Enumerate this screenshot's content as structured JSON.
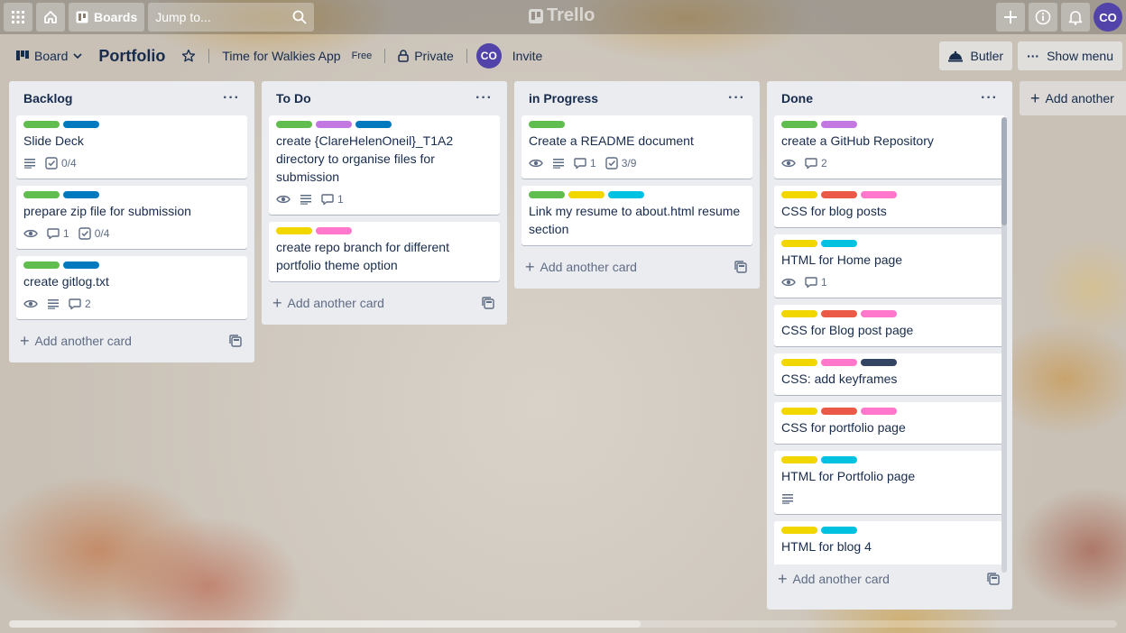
{
  "header": {
    "boards_label": "Boards",
    "search_placeholder": "Jump to...",
    "logo_text": "Trello",
    "avatar_initials": "CO"
  },
  "board": {
    "view_label": "Board",
    "title": "Portfolio",
    "workspace": "Time for Walkies App",
    "plan": "Free",
    "visibility": "Private",
    "member_initials": "CO",
    "invite_label": "Invite",
    "butler_label": "Butler",
    "show_menu_label": "Show menu"
  },
  "add_another_card": "Add another card",
  "add_another_list": "Add another",
  "colors": {
    "green": "#61bd4f",
    "blue": "#0079bf",
    "purple": "#c377e0",
    "yellow": "#f2d600",
    "pink": "#ff78cb",
    "red": "#eb5a46",
    "sky": "#00c2e0",
    "black": "#344563"
  },
  "lists": [
    {
      "name": "Backlog",
      "cards": [
        {
          "title": "Slide Deck",
          "labels": [
            "green",
            "blue"
          ],
          "badges": {
            "description": true,
            "checklist": "0/4"
          }
        },
        {
          "title": "prepare zip file for submission",
          "labels": [
            "green",
            "blue"
          ],
          "badges": {
            "watch": true,
            "comments": "1",
            "checklist": "0/4"
          }
        },
        {
          "title": "create gitlog.txt",
          "labels": [
            "green",
            "blue"
          ],
          "badges": {
            "watch": true,
            "description": true,
            "comments": "2"
          }
        }
      ]
    },
    {
      "name": "To Do",
      "cards": [
        {
          "title": "create {ClareHelenOneil}_T1A2 directory to organise files for submission",
          "labels": [
            "green",
            "purple",
            "blue"
          ],
          "badges": {
            "watch": true,
            "description": true,
            "comments": "1"
          }
        },
        {
          "title": "create repo branch for different portfolio theme option",
          "labels": [
            "yellow",
            "pink"
          ],
          "badges": {}
        }
      ]
    },
    {
      "name": "in Progress",
      "cards": [
        {
          "title": "Create a README document",
          "labels": [
            "green"
          ],
          "badges": {
            "watch": true,
            "description": true,
            "comments": "1",
            "checklist": "3/9"
          }
        },
        {
          "title": "Link my resume to about.html resume section",
          "labels": [
            "green",
            "yellow",
            "sky"
          ],
          "badges": {}
        }
      ]
    },
    {
      "name": "Done",
      "cards": [
        {
          "title": "create a GitHub Repository",
          "labels": [
            "green",
            "purple"
          ],
          "badges": {
            "watch": true,
            "comments": "2"
          }
        },
        {
          "title": "CSS for blog posts",
          "labels": [
            "yellow",
            "red",
            "pink"
          ],
          "badges": {}
        },
        {
          "title": "HTML for Home page",
          "labels": [
            "yellow",
            "sky"
          ],
          "badges": {
            "watch": true,
            "comments": "1"
          }
        },
        {
          "title": "CSS for Blog post page",
          "labels": [
            "yellow",
            "red",
            "pink"
          ],
          "badges": {}
        },
        {
          "title": "CSS: add keyframes",
          "labels": [
            "yellow",
            "pink",
            "black"
          ],
          "badges": {}
        },
        {
          "title": "CSS for portfolio page",
          "labels": [
            "yellow",
            "red",
            "pink"
          ],
          "badges": {}
        },
        {
          "title": "HTML for Portfolio page",
          "labels": [
            "yellow",
            "sky"
          ],
          "badges": {
            "description": true
          }
        },
        {
          "title": "HTML for blog 4",
          "labels": [
            "yellow",
            "sky"
          ],
          "badges": {
            "description": true
          }
        }
      ]
    }
  ]
}
